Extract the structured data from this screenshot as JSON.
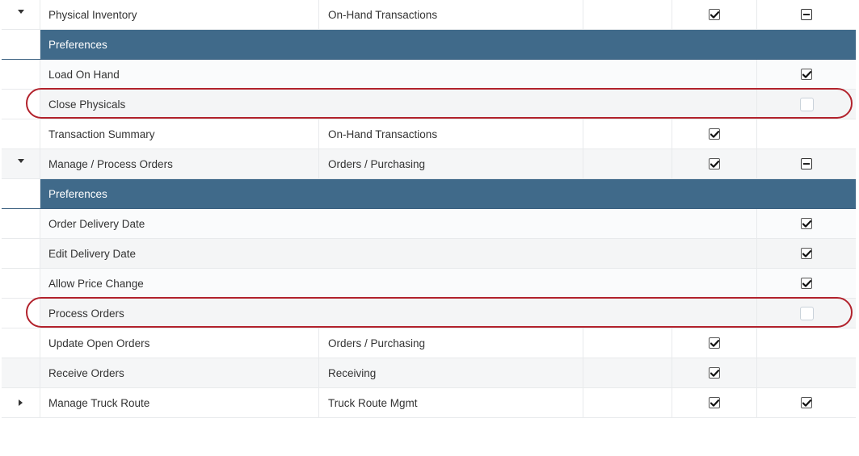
{
  "rows": [
    {
      "type": "item",
      "expander": "expanded",
      "name": "Physical Inventory",
      "group": "On-Hand Transactions",
      "check1": "checked",
      "check2": "indeterminate"
    },
    {
      "type": "header",
      "label": "Preferences"
    },
    {
      "type": "pref",
      "name": "Load On Hand",
      "check": "checked"
    },
    {
      "type": "pref",
      "name": "Close Physicals",
      "check": "unchecked",
      "highlighted": true
    },
    {
      "type": "item",
      "expander": "none",
      "name": "Transaction Summary",
      "group": "On-Hand Transactions",
      "check1": "checked",
      "check2": "none"
    },
    {
      "type": "item",
      "expander": "expanded",
      "name": "Manage / Process Orders",
      "group": "Orders / Purchasing",
      "check1": "checked",
      "check2": "indeterminate"
    },
    {
      "type": "header",
      "label": "Preferences"
    },
    {
      "type": "pref",
      "name": "Order Delivery Date",
      "check": "checked"
    },
    {
      "type": "pref",
      "name": "Edit Delivery Date",
      "check": "checked"
    },
    {
      "type": "pref",
      "name": "Allow Price Change",
      "check": "checked"
    },
    {
      "type": "pref",
      "name": "Process Orders",
      "check": "unchecked",
      "highlighted": true
    },
    {
      "type": "item",
      "expander": "none",
      "name": "Update Open Orders",
      "group": "Orders / Purchasing",
      "check1": "checked",
      "check2": "none"
    },
    {
      "type": "item",
      "expander": "none",
      "name": "Receive Orders",
      "group": "Receiving",
      "check1": "checked",
      "check2": "none"
    },
    {
      "type": "item",
      "expander": "collapsed",
      "name": "Manage Truck Route",
      "group": "Truck Route Mgmt",
      "check1": "checked",
      "check2": "checked"
    }
  ],
  "colors": {
    "header_bg": "#406a8a",
    "highlight": "#b2222c",
    "row_alt": "#f5f6f7"
  }
}
